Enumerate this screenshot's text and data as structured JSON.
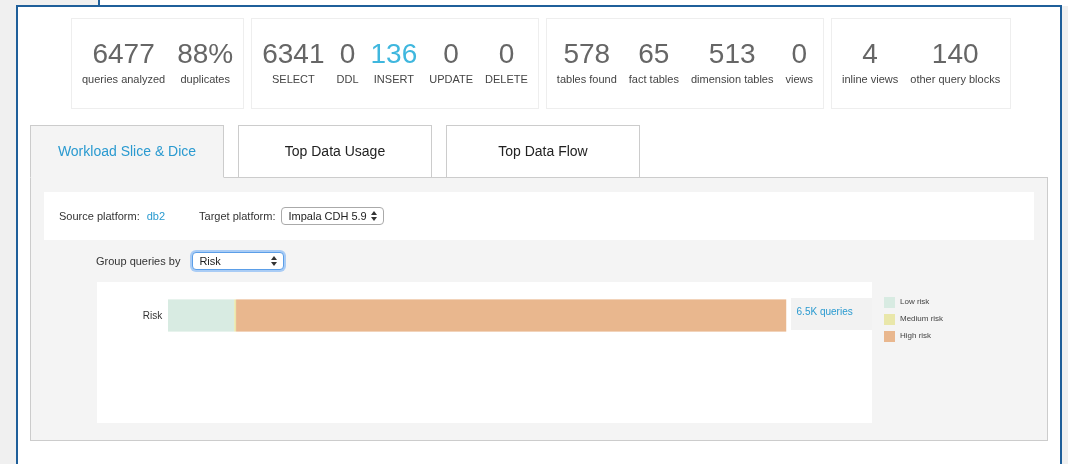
{
  "stat_groups": [
    {
      "stats": [
        {
          "value": "6477",
          "label": "queries analyzed",
          "highlight": false
        },
        {
          "value": "88%",
          "label": "duplicates",
          "highlight": false
        }
      ]
    },
    {
      "stats": [
        {
          "value": "6341",
          "label": "SELECT",
          "highlight": false
        },
        {
          "value": "0",
          "label": "DDL",
          "highlight": false
        },
        {
          "value": "136",
          "label": "INSERT",
          "highlight": true
        },
        {
          "value": "0",
          "label": "UPDATE",
          "highlight": false
        },
        {
          "value": "0",
          "label": "DELETE",
          "highlight": false
        }
      ]
    },
    {
      "stats": [
        {
          "value": "578",
          "label": "tables found",
          "highlight": false
        },
        {
          "value": "65",
          "label": "fact tables",
          "highlight": false
        },
        {
          "value": "513",
          "label": "dimension tables",
          "highlight": false
        },
        {
          "value": "0",
          "label": "views",
          "highlight": false
        }
      ]
    },
    {
      "stats": [
        {
          "value": "4",
          "label": "inline views",
          "highlight": false
        },
        {
          "value": "140",
          "label": "other query blocks",
          "highlight": false
        }
      ]
    }
  ],
  "tabs": [
    {
      "label": "Workload Slice & Dice",
      "selected": true
    },
    {
      "label": "Top Data Usage",
      "selected": false
    },
    {
      "label": "Top Data Flow",
      "selected": false
    }
  ],
  "platforms": {
    "source_label": "Source platform:",
    "source_value": "db2",
    "target_label": "Target platform:",
    "target_value": "Impala CDH 5.9"
  },
  "group_by": {
    "label": "Group queries by",
    "value": "Risk"
  },
  "risk_chart": {
    "row_label": "Risk",
    "total": "6.5K queries",
    "legend": [
      {
        "label": "Low risk",
        "color": "#d8ebe2"
      },
      {
        "label": "Medium risk",
        "color": "#e9e7aa"
      },
      {
        "label": "High risk",
        "color": "#e9b78e"
      }
    ]
  }
}
